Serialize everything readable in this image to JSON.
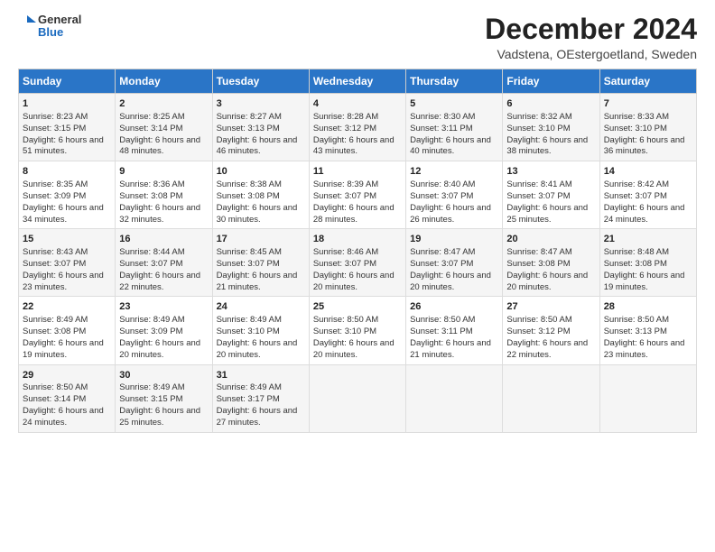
{
  "logo": {
    "general": "General",
    "blue": "Blue"
  },
  "header": {
    "title": "December 2024",
    "subtitle": "Vadstena, OEstergoetland, Sweden"
  },
  "columns": [
    "Sunday",
    "Monday",
    "Tuesday",
    "Wednesday",
    "Thursday",
    "Friday",
    "Saturday"
  ],
  "weeks": [
    [
      {
        "day": "1",
        "info": "Sunrise: 8:23 AM\nSunset: 3:15 PM\nDaylight: 6 hours and 51 minutes."
      },
      {
        "day": "2",
        "info": "Sunrise: 8:25 AM\nSunset: 3:14 PM\nDaylight: 6 hours and 48 minutes."
      },
      {
        "day": "3",
        "info": "Sunrise: 8:27 AM\nSunset: 3:13 PM\nDaylight: 6 hours and 46 minutes."
      },
      {
        "day": "4",
        "info": "Sunrise: 8:28 AM\nSunset: 3:12 PM\nDaylight: 6 hours and 43 minutes."
      },
      {
        "day": "5",
        "info": "Sunrise: 8:30 AM\nSunset: 3:11 PM\nDaylight: 6 hours and 40 minutes."
      },
      {
        "day": "6",
        "info": "Sunrise: 8:32 AM\nSunset: 3:10 PM\nDaylight: 6 hours and 38 minutes."
      },
      {
        "day": "7",
        "info": "Sunrise: 8:33 AM\nSunset: 3:10 PM\nDaylight: 6 hours and 36 minutes."
      }
    ],
    [
      {
        "day": "8",
        "info": "Sunrise: 8:35 AM\nSunset: 3:09 PM\nDaylight: 6 hours and 34 minutes."
      },
      {
        "day": "9",
        "info": "Sunrise: 8:36 AM\nSunset: 3:08 PM\nDaylight: 6 hours and 32 minutes."
      },
      {
        "day": "10",
        "info": "Sunrise: 8:38 AM\nSunset: 3:08 PM\nDaylight: 6 hours and 30 minutes."
      },
      {
        "day": "11",
        "info": "Sunrise: 8:39 AM\nSunset: 3:07 PM\nDaylight: 6 hours and 28 minutes."
      },
      {
        "day": "12",
        "info": "Sunrise: 8:40 AM\nSunset: 3:07 PM\nDaylight: 6 hours and 26 minutes."
      },
      {
        "day": "13",
        "info": "Sunrise: 8:41 AM\nSunset: 3:07 PM\nDaylight: 6 hours and 25 minutes."
      },
      {
        "day": "14",
        "info": "Sunrise: 8:42 AM\nSunset: 3:07 PM\nDaylight: 6 hours and 24 minutes."
      }
    ],
    [
      {
        "day": "15",
        "info": "Sunrise: 8:43 AM\nSunset: 3:07 PM\nDaylight: 6 hours and 23 minutes."
      },
      {
        "day": "16",
        "info": "Sunrise: 8:44 AM\nSunset: 3:07 PM\nDaylight: 6 hours and 22 minutes."
      },
      {
        "day": "17",
        "info": "Sunrise: 8:45 AM\nSunset: 3:07 PM\nDaylight: 6 hours and 21 minutes."
      },
      {
        "day": "18",
        "info": "Sunrise: 8:46 AM\nSunset: 3:07 PM\nDaylight: 6 hours and 20 minutes."
      },
      {
        "day": "19",
        "info": "Sunrise: 8:47 AM\nSunset: 3:07 PM\nDaylight: 6 hours and 20 minutes."
      },
      {
        "day": "20",
        "info": "Sunrise: 8:47 AM\nSunset: 3:08 PM\nDaylight: 6 hours and 20 minutes."
      },
      {
        "day": "21",
        "info": "Sunrise: 8:48 AM\nSunset: 3:08 PM\nDaylight: 6 hours and 19 minutes."
      }
    ],
    [
      {
        "day": "22",
        "info": "Sunrise: 8:49 AM\nSunset: 3:08 PM\nDaylight: 6 hours and 19 minutes."
      },
      {
        "day": "23",
        "info": "Sunrise: 8:49 AM\nSunset: 3:09 PM\nDaylight: 6 hours and 20 minutes."
      },
      {
        "day": "24",
        "info": "Sunrise: 8:49 AM\nSunset: 3:10 PM\nDaylight: 6 hours and 20 minutes."
      },
      {
        "day": "25",
        "info": "Sunrise: 8:50 AM\nSunset: 3:10 PM\nDaylight: 6 hours and 20 minutes."
      },
      {
        "day": "26",
        "info": "Sunrise: 8:50 AM\nSunset: 3:11 PM\nDaylight: 6 hours and 21 minutes."
      },
      {
        "day": "27",
        "info": "Sunrise: 8:50 AM\nSunset: 3:12 PM\nDaylight: 6 hours and 22 minutes."
      },
      {
        "day": "28",
        "info": "Sunrise: 8:50 AM\nSunset: 3:13 PM\nDaylight: 6 hours and 23 minutes."
      }
    ],
    [
      {
        "day": "29",
        "info": "Sunrise: 8:50 AM\nSunset: 3:14 PM\nDaylight: 6 hours and 24 minutes."
      },
      {
        "day": "30",
        "info": "Sunrise: 8:49 AM\nSunset: 3:15 PM\nDaylight: 6 hours and 25 minutes."
      },
      {
        "day": "31",
        "info": "Sunrise: 8:49 AM\nSunset: 3:17 PM\nDaylight: 6 hours and 27 minutes."
      },
      {
        "day": "",
        "info": ""
      },
      {
        "day": "",
        "info": ""
      },
      {
        "day": "",
        "info": ""
      },
      {
        "day": "",
        "info": ""
      }
    ]
  ]
}
